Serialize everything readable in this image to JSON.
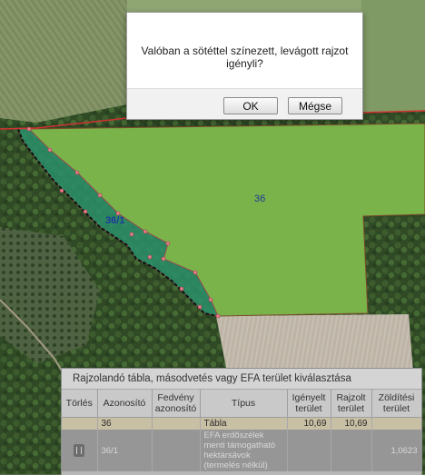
{
  "map": {
    "labels": {
      "parcel_main": "36",
      "parcel_strip": "36/1"
    }
  },
  "dialog": {
    "message": "Valóban a sötéttel színezett, levágott rajzot igényli?",
    "ok_label": "OK",
    "cancel_label": "Mégse"
  },
  "panel": {
    "title": "Rajzolandó tábla, másodvetés vagy EFA terület kiválasztása",
    "headers": {
      "delete": "Törlés",
      "id": "Azonosító",
      "cover_id": "Fedvény azonosító",
      "type": "Típus",
      "claimed_area": "Igényelt terület",
      "drawn_area": "Rajzolt terület",
      "green_area": "Zöldítési terület"
    },
    "rows": [
      {
        "delete": "",
        "id": "36",
        "cover_id": "",
        "type": "Tábla",
        "claimed_area": "10,69",
        "drawn_area": "10,69",
        "green_area": ""
      },
      {
        "delete": "trash",
        "id": "36/1",
        "cover_id": "",
        "type": "EFA erdőszélek menti támogatható hektársávok (termelés nélkül)",
        "claimed_area": "",
        "drawn_area": "",
        "green_area": "1,0623"
      }
    ]
  }
}
